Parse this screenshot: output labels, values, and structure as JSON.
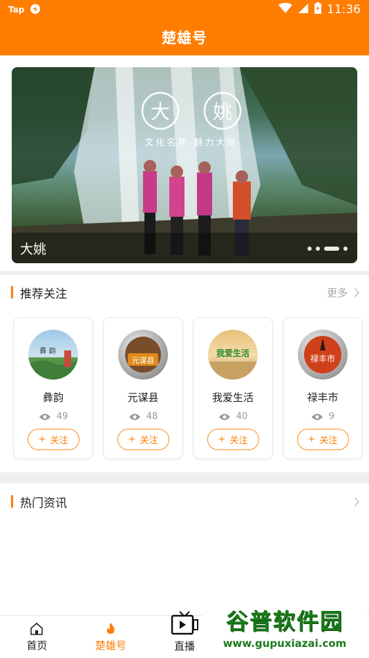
{
  "status_bar": {
    "left_text": "Tap",
    "time": "11:36"
  },
  "header": {
    "title": "楚雄号"
  },
  "banner": {
    "caption": "大姚",
    "image_title_chars": [
      "大",
      "姚"
    ],
    "image_subtitle": "文化名邦 魅力大姚",
    "dots": 4,
    "active_dot": 2
  },
  "recommend": {
    "title": "推荐关注",
    "more_label": "更多",
    "follow_label": "关注",
    "follow_plus": "+",
    "cards": [
      {
        "name": "彝韵",
        "views": "49",
        "avatar_text": "彝 韵"
      },
      {
        "name": "元谋县",
        "views": "48",
        "avatar_text": "元谋县"
      },
      {
        "name": "我爱生活",
        "views": "40",
        "avatar_text": "我爱生活"
      },
      {
        "name": "禄丰市",
        "views": "9",
        "avatar_text": "禄丰市"
      }
    ]
  },
  "hot_news": {
    "title": "热门资讯"
  },
  "tabbar": {
    "items": [
      {
        "label": "首页",
        "icon": "home-icon"
      },
      {
        "label": "楚雄号",
        "icon": "flame-icon"
      },
      {
        "label": "直播",
        "icon": "tv-icon"
      },
      {
        "label": "",
        "icon": ""
      },
      {
        "label": "",
        "icon": ""
      }
    ]
  },
  "watermark": {
    "main": "谷普软件园",
    "sub": "www.gupuxiazai.com"
  },
  "colors": {
    "accent": "#ff7d00",
    "background": "#ffffff",
    "divider": "#efefef"
  }
}
